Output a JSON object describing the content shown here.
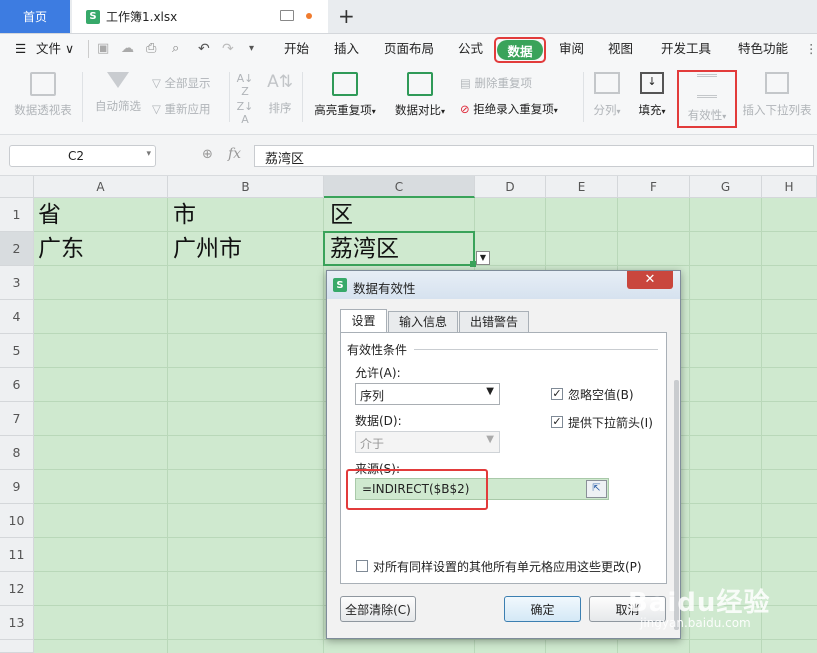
{
  "tabs": {
    "home": "首页",
    "doc": "工作簿1.xlsx",
    "add": "+"
  },
  "menu": {
    "file": "文件",
    "items": [
      "开始",
      "插入",
      "页面布局",
      "公式",
      "数据",
      "审阅",
      "视图",
      "开发工具",
      "特色功能"
    ]
  },
  "ribbon": {
    "pivot": "数据透视表",
    "autofilter": "自动筛选",
    "show_all": "全部显示",
    "reapply": "重新应用",
    "sort": "排序",
    "highlight_dup": "高亮重复项",
    "compare": "数据对比",
    "remove_dup": "删除重复项",
    "reject_dup": "拒绝录入重复项",
    "split": "分列",
    "fill": "填充",
    "validity": "有效性",
    "insert_dropdown": "插入下拉列表"
  },
  "formula_bar": {
    "name_box": "C2",
    "fx": "fx",
    "value": "荔湾区"
  },
  "columns": [
    "A",
    "B",
    "C",
    "D",
    "E",
    "F",
    "G",
    "H"
  ],
  "rows": [
    "1",
    "2",
    "3",
    "4",
    "5",
    "6",
    "7",
    "8",
    "9",
    "10",
    "11",
    "12",
    "13"
  ],
  "cells": {
    "a1": "省",
    "b1": "市",
    "c1": "区",
    "a2": "广东",
    "b2": "广州市",
    "c2": "荔湾区"
  },
  "dialog": {
    "title": "数据有效性",
    "tabs": [
      "设置",
      "输入信息",
      "出错警告"
    ],
    "section": "有效性条件",
    "allow_label": "允许(A):",
    "allow_value": "序列",
    "data_label": "数据(D):",
    "data_value": "介于",
    "ignore_blank": "忽略空值(B)",
    "dropdown_arrow": "提供下拉箭头(I)",
    "source_label": "来源(S):",
    "source_value": "=INDIRECT($B$2)",
    "apply_all": "对所有同样设置的其他所有单元格应用这些更改(P)",
    "clear_all": "全部清除(C)",
    "ok": "确定",
    "cancel": "取消"
  },
  "watermark": {
    "brand": "Baidu经验",
    "url": "jingyan.baidu.com"
  },
  "colors": {
    "accent_green": "#3aa35a",
    "highlight_red": "#e23b3b",
    "grid_fill": "#cfe9cf",
    "home_tab": "#3d7ce1"
  }
}
